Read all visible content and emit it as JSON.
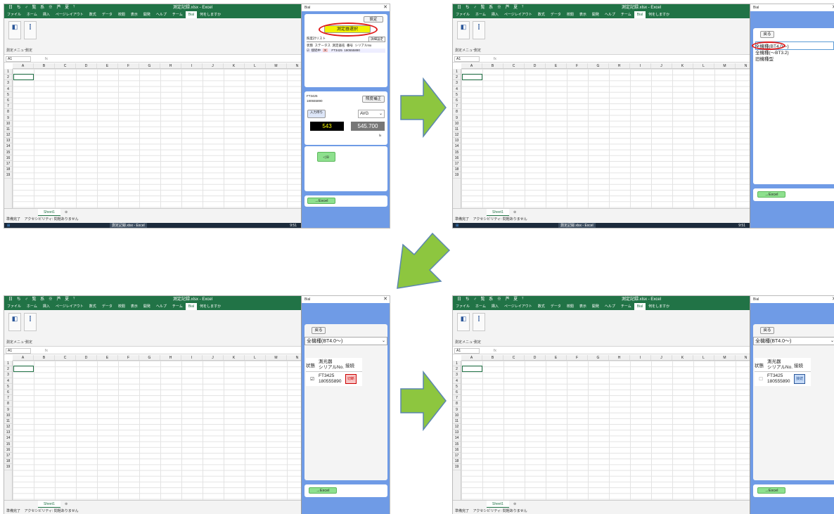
{
  "excel": {
    "title": "測定記録.xlsx - Excel",
    "quick_access": "日 ち ♂ 覧 系 ※ 芦 夏 ᵀ",
    "menu": [
      "ファイル",
      "ホーム",
      "挿入",
      "ページレイアウト",
      "数式",
      "データ",
      "校閲",
      "表示",
      "開発",
      "ヘルプ",
      "チーム",
      "Bial"
    ],
    "menu_selected": "Bial",
    "tell_me": "何をしますか",
    "ribbon_labels": [
      "測定メニュー",
      "測定"
    ],
    "name_box": "A1",
    "fx": "fx",
    "columns": [
      "A",
      "B",
      "C",
      "D",
      "E",
      "F",
      "G",
      "H",
      "I",
      "J",
      "K",
      "L",
      "M",
      "N"
    ],
    "rows": [
      "1",
      "2",
      "3",
      "4",
      "5",
      "6",
      "7",
      "8",
      "9",
      "10",
      "11",
      "12",
      "13",
      "14",
      "15",
      "16",
      "17",
      "18",
      "19"
    ],
    "sheet_tab": "Sheet1",
    "status": "準備完了",
    "status2": "アクセシビリティ: 問題ありません",
    "taskbar_app": "測定記録.xlsx - Excel",
    "taskbar_app2": "Bial",
    "taskbar_clock": "9:51"
  },
  "panel1": {
    "title": "Bial",
    "settings_btn": "設定",
    "select_btn": "測定器選択",
    "tab_left": "照度計リスト",
    "tab_right": "詳細設定",
    "table_headers": [
      "状態",
      "ステータス",
      "測定器名",
      "番号",
      "シリアルNo"
    ],
    "table_row": [
      "☑",
      "接続中",
      "✕",
      "FT3425",
      "180555890"
    ],
    "device_name": "FT3425",
    "device_serial": "180555890",
    "zero_btn": "照度補正",
    "input_btn": "入力待ち",
    "mode": "AVG",
    "value_live": "543",
    "value_avg": "545.700",
    "unit": "lx",
    "record_btn": "◁①",
    "export_btn": "→Excel"
  },
  "panel2": {
    "title": "Bial",
    "back_btn": "戻る",
    "options": [
      "全機種(BT4.0〜)",
      "全機種(〜BT3.2)",
      "旧機種型"
    ],
    "export_btn": "→Excel"
  },
  "panel3": {
    "title": "Bial",
    "back_btn": "戻る",
    "selected": "全機種(BT4.0〜)",
    "headers": [
      "状態",
      "測光器\nシリアルNo.",
      "接続"
    ],
    "device": "FT3425\n180555890",
    "checked": "☑",
    "conn_label": "切断",
    "export_btn": "→Excel"
  },
  "panel4": {
    "title": "Bial",
    "back_btn": "戻る",
    "selected": "全機種(BT4.0〜)",
    "headers": [
      "状態",
      "測光器\nシリアルNo.",
      "接続"
    ],
    "device": "FT3425\n180555890",
    "checked": "☐",
    "conn_label": "接続",
    "export_btn": "→Excel"
  },
  "colors": {
    "excel_green": "#217346",
    "side_blue": "#6f9be6",
    "arrow_green": "#8dc63f",
    "highlight_red": "#e01a1a",
    "yellow": "#f2f200"
  }
}
